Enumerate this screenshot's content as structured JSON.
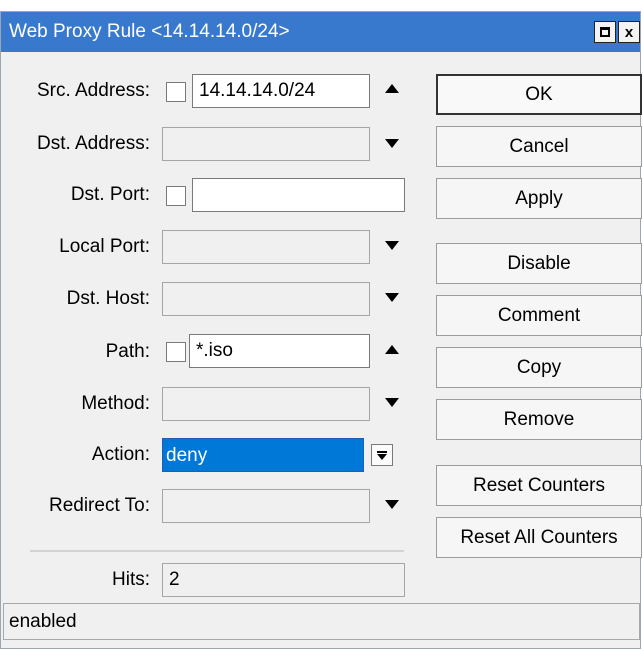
{
  "window": {
    "title": "Web Proxy Rule <14.14.14.0/24>",
    "maximize_icon": "maximize-icon",
    "close_glyph": "x",
    "title_bar_color": "#3979cd"
  },
  "form": {
    "src_address": {
      "label": "Src. Address:",
      "value": "14.14.14.0/24",
      "negated": false
    },
    "dst_address": {
      "label": "Dst. Address:",
      "value": ""
    },
    "dst_port": {
      "label": "Dst. Port:",
      "value": "",
      "negated": false
    },
    "local_port": {
      "label": "Local Port:",
      "value": ""
    },
    "dst_host": {
      "label": "Dst. Host:",
      "value": ""
    },
    "path": {
      "label": "Path:",
      "value": "*.iso",
      "negated": false
    },
    "method": {
      "label": "Method:",
      "value": ""
    },
    "action": {
      "label": "Action:",
      "value": "deny"
    },
    "redirect_to": {
      "label": "Redirect To:",
      "value": ""
    },
    "hits": {
      "label": "Hits:",
      "value": "2"
    }
  },
  "buttons": {
    "ok": "OK",
    "cancel": "Cancel",
    "apply": "Apply",
    "disable": "Disable",
    "comment": "Comment",
    "copy": "Copy",
    "remove": "Remove",
    "reset_counters": "Reset Counters",
    "reset_all_counters": "Reset All Counters"
  },
  "status": {
    "text": "enabled"
  }
}
